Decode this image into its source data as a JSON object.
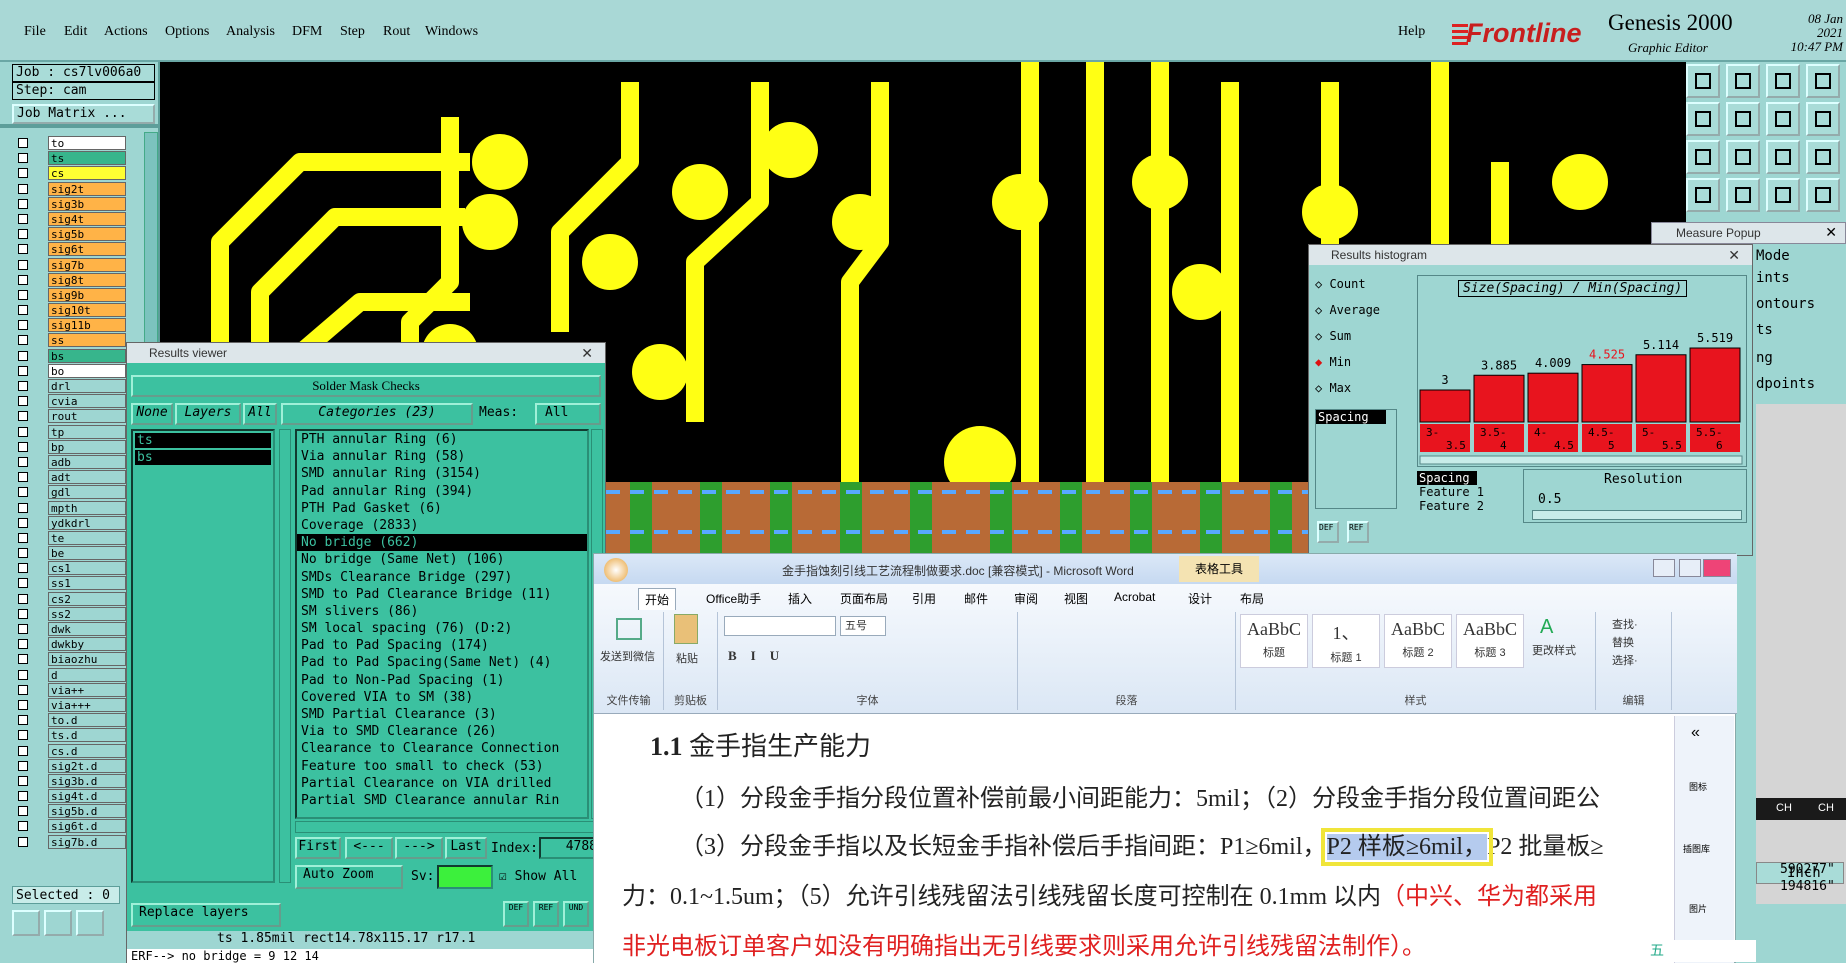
{
  "menubar": {
    "items": [
      "File",
      "Edit",
      "Actions",
      "Options",
      "Analysis",
      "DFM",
      "Step",
      "Rout",
      "Windows"
    ],
    "help": "Help",
    "logo_text": "Frontline",
    "app_title": "Genesis 2000",
    "app_subtitle": "Graphic Editor",
    "date": "08 Jan 2021",
    "time": "10:47 PM"
  },
  "left": {
    "job": "Job : cs7lv006a0",
    "step": "Step: cam",
    "job_matrix": "Job Matrix ...",
    "selected": "Selected : 0",
    "layers": [
      {
        "name": "to",
        "color": "#ffffff"
      },
      {
        "name": "ts",
        "color": "#37b58c"
      },
      {
        "name": "cs",
        "color": "#ffff33"
      },
      {
        "name": "sig2t",
        "color": "#ffb347"
      },
      {
        "name": "sig3b",
        "color": "#ffb347"
      },
      {
        "name": "sig4t",
        "color": "#ffb347"
      },
      {
        "name": "sig5b",
        "color": "#ffb347"
      },
      {
        "name": "sig6t",
        "color": "#ffb347"
      },
      {
        "name": "sig7b",
        "color": "#ffb347"
      },
      {
        "name": "sig8t",
        "color": "#ffb347"
      },
      {
        "name": "sig9b",
        "color": "#ffb347"
      },
      {
        "name": "sig10t",
        "color": "#ffb347"
      },
      {
        "name": "sig11b",
        "color": "#ffb347"
      },
      {
        "name": "ss",
        "color": "#ffb347"
      },
      {
        "name": "bs",
        "color": "#37b58c"
      },
      {
        "name": "bo",
        "color": "#ffffff"
      },
      {
        "name": "drl",
        "color": "#9ed6d2"
      },
      {
        "name": "cvia",
        "color": "#9ed6d2"
      },
      {
        "name": "rout",
        "color": "#9ed6d2"
      },
      {
        "name": "tp",
        "color": "#9ed6d2"
      },
      {
        "name": "bp",
        "color": "#9ed6d2"
      },
      {
        "name": "adb",
        "color": "#9ed6d2"
      },
      {
        "name": "adt",
        "color": "#9ed6d2"
      },
      {
        "name": "gdl",
        "color": "#9ed6d2"
      },
      {
        "name": "mpth",
        "color": "#9ed6d2"
      },
      {
        "name": "ydkdrl",
        "color": "#9ed6d2"
      },
      {
        "name": "te",
        "color": "#9ed6d2"
      },
      {
        "name": "be",
        "color": "#9ed6d2"
      },
      {
        "name": "cs1",
        "color": "#9ed6d2"
      },
      {
        "name": "ss1",
        "color": "#9ed6d2"
      },
      {
        "name": "cs2",
        "color": "#9ed6d2"
      },
      {
        "name": "ss2",
        "color": "#9ed6d2"
      },
      {
        "name": "dwk",
        "color": "#9ed6d2"
      },
      {
        "name": "dwkby",
        "color": "#9ed6d2"
      },
      {
        "name": "biaozhu",
        "color": "#9ed6d2"
      },
      {
        "name": "d",
        "color": "#9ed6d2"
      },
      {
        "name": "via++",
        "color": "#9ed6d2"
      },
      {
        "name": "via+++",
        "color": "#9ed6d2"
      },
      {
        "name": "to.d",
        "color": "#9ed6d2"
      },
      {
        "name": "ts.d",
        "color": "#9ed6d2"
      },
      {
        "name": "cs.d",
        "color": "#9ed6d2"
      },
      {
        "name": "sig2t.d",
        "color": "#9ed6d2"
      },
      {
        "name": "sig3b.d",
        "color": "#9ed6d2"
      },
      {
        "name": "sig4t.d",
        "color": "#9ed6d2"
      },
      {
        "name": "sig5b.d",
        "color": "#9ed6d2"
      },
      {
        "name": "sig6t.d",
        "color": "#9ed6d2"
      },
      {
        "name": "sig7b.d",
        "color": "#9ed6d2"
      }
    ]
  },
  "results_viewer": {
    "title": "Results viewer",
    "header": "Solder Mask Checks",
    "btn_none": "None",
    "btn_layers": "Layers",
    "btn_all": "All",
    "categories_label": "Categories (23)",
    "meas_label": "Meas:",
    "meas_value": "All",
    "layers_list": [
      "ts",
      "bs"
    ],
    "categories": [
      "PTH annular Ring (6)",
      "Via annular Ring (58)",
      "SMD annular Ring (3154)",
      "Pad annular Ring (394)",
      "PTH Pad Gasket (6)",
      "Coverage (2833)",
      "No bridge (662)",
      "No bridge (Same Net) (106)",
      "SMDs Clearance Bridge (297)",
      "SMD to Pad Clearance Bridge (11)",
      "SM slivers (86)",
      "SM local spacing (76)       (D:2)",
      "Pad to Pad Spacing (174)",
      "Pad to Pad Spacing(Same Net) (4)",
      "Pad to Non-Pad Spacing (1)",
      "Covered VIA to SM (38)",
      "SMD Partial Clearance (3)",
      "Via to SMD Clearance (26)",
      "Clearance to Clearance Connection",
      "Feature too small to check (53)",
      "Partial Clearance on VIA drilled",
      "Partial SMD Clearance annular Rin"
    ],
    "selected_category": "No bridge (662)",
    "nav_first": "First",
    "nav_prev": "<---",
    "nav_next": "--->",
    "nav_last": "Last",
    "index_label": "Index:",
    "index_value": "4788",
    "auto_zoom": "Auto Zoom",
    "sv_label": "Sv:",
    "show_all": "Show All",
    "replace_layers": "Replace layers",
    "btn_def": "DEF",
    "btn_ref": "REF",
    "btn_und": "UND",
    "status": "ts 1.85mil  rect14.78x115.17  r17.1",
    "erf": "ERF--> no bridge = 9 12 14"
  },
  "measure_popup": {
    "title": "Measure Popup"
  },
  "histogram": {
    "title": "Results histogram",
    "options": [
      "Count",
      "Average",
      "Sum",
      "Min",
      "Max"
    ],
    "selected_option": "Min",
    "spacing_field": "Spacing",
    "chart_title": "Size(Spacing) / Min(Spacing)",
    "bar_values": [
      "3",
      "3.885",
      "4.009",
      "4.525",
      "5.114",
      "5.519"
    ],
    "bar_value_numbers": [
      3,
      3.885,
      4.009,
      4.525,
      5.114,
      5.519
    ],
    "highlight_index": 3,
    "bin_labels_top": [
      "3-",
      "3.5-",
      "4-",
      "4.5-",
      "5-",
      "5.5-"
    ],
    "bin_labels_bottom": [
      "3.5",
      "4",
      "4.5",
      "5",
      "5.5",
      "6"
    ],
    "table_labels": [
      "Spacing",
      "Feature 1",
      "Feature 2"
    ],
    "resolution_label": "Resolution",
    "resolution_value": "0.5",
    "btn_def": "DEF",
    "btn_ref": "REF"
  },
  "right_menu": [
    "Mode",
    "ints",
    "ontours",
    "ts",
    "ng",
    "dpoints"
  ],
  "right_status": {
    "coord1": "590277\"",
    "coord2": "194816\"",
    "unit": "Inch",
    "ch1": "CH",
    "ch2": "CH"
  },
  "word": {
    "title": "金手指蚀刻引线工艺流程制做要求.doc [兼容模式] - Microsoft Word",
    "table_tools": "表格工具",
    "tabs": [
      "开始",
      "Office助手",
      "插入",
      "页面布局",
      "引用",
      "邮件",
      "审阅",
      "视图",
      "Acrobat",
      "设计",
      "布局"
    ],
    "active_tab": "开始",
    "groups": [
      "文件传输",
      "剪贴板",
      "字体",
      "段落",
      "样式",
      "编辑"
    ],
    "send_to_wechat": "发送到微信",
    "paste": "粘贴",
    "font_size": "五号",
    "styles": [
      {
        "preview": "AaBbC",
        "label": "标题"
      },
      {
        "preview": "1、",
        "label": "标题 1"
      },
      {
        "preview": "AaBbC",
        "label": "标题 2"
      },
      {
        "preview": "AaBbC",
        "label": "标题 3"
      }
    ],
    "change_styles": "更改样式",
    "edit_items": [
      "查找·",
      "替换",
      "选择·"
    ],
    "side_icons": [
      "图标",
      "插图库",
      "图片"
    ],
    "heading_num": "1.1",
    "heading_text": "金手指生产能力",
    "p1": "（1）分段金手指分段位置补偿前最小间距能力：5mil；（2）分段金手指分段位置间距公",
    "p2a": "（3）分段金手指以及长短金手指补偿后手指间距：P1≥6mil，",
    "p2b": "P2 样板≥6mil，",
    "p2c": "P2 批量板≥",
    "p3a": "力：0.1~1.5um；（5）允许引线残留法引线残留长度可控制在 0.1mm 以内",
    "p3b": "（中兴、华为都采用",
    "p4": "非光电板订单客户如没有明确指出无引线要求则采用允许引线残留法制作）。",
    "ime": "五"
  }
}
